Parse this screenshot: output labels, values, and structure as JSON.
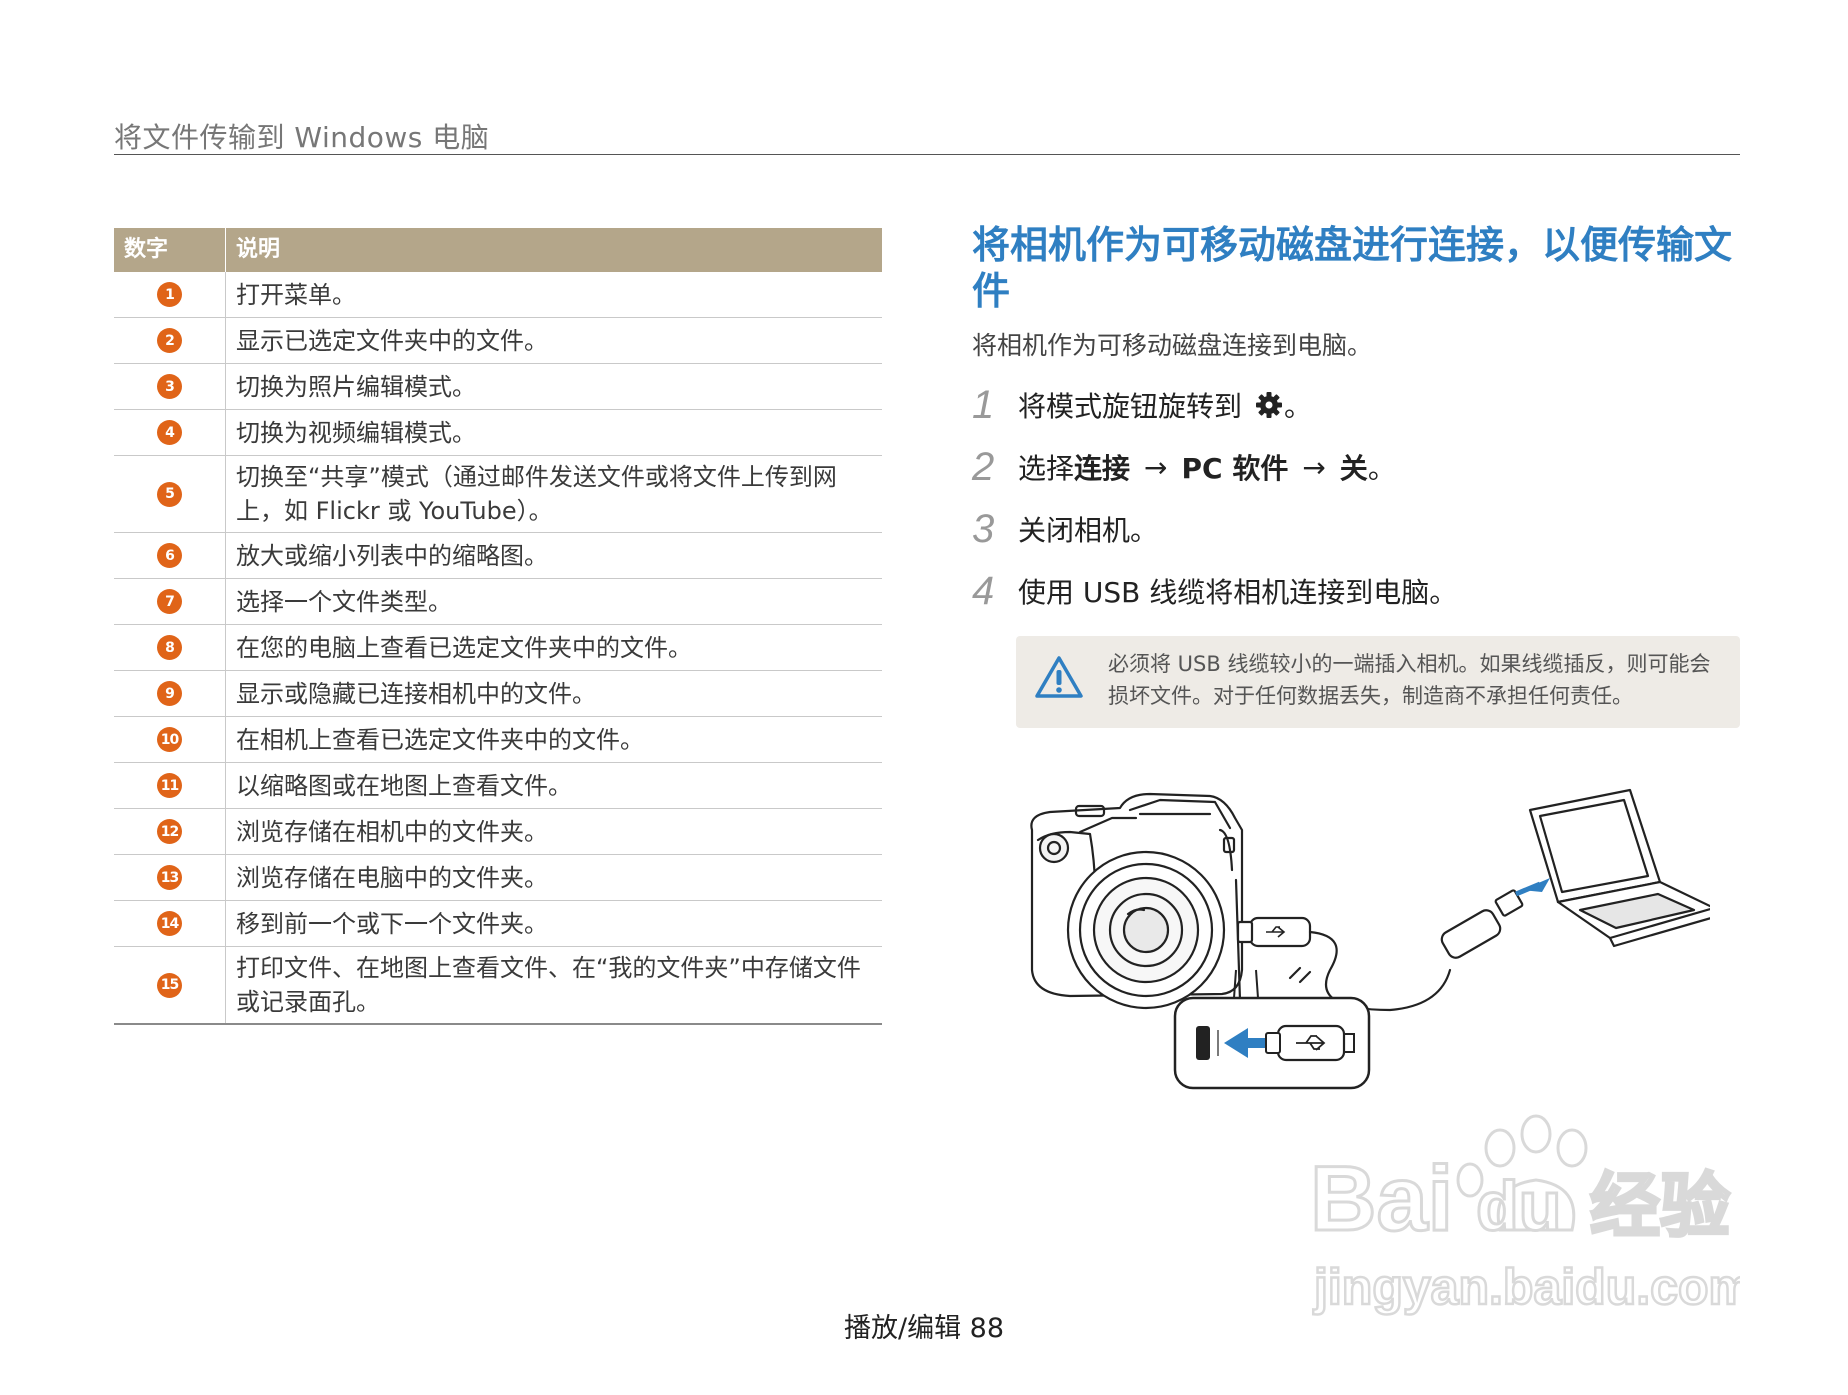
{
  "header": {
    "title": "将文件传输到 Windows 电脑"
  },
  "table": {
    "headers": [
      "数字",
      "说明"
    ],
    "rows": [
      {
        "num": "1",
        "desc": "打开菜单。"
      },
      {
        "num": "2",
        "desc": "显示已选定文件夹中的文件。"
      },
      {
        "num": "3",
        "desc": "切换为照片编辑模式。"
      },
      {
        "num": "4",
        "desc": "切换为视频编辑模式。"
      },
      {
        "num": "5",
        "desc": "切换至“共享”模式（通过邮件发送文件或将文件上传到网上，如 Flickr 或 YouTube）。"
      },
      {
        "num": "6",
        "desc": "放大或缩小列表中的缩略图。"
      },
      {
        "num": "7",
        "desc": "选择一个文件类型。"
      },
      {
        "num": "8",
        "desc": "在您的电脑上查看已选定文件夹中的文件。"
      },
      {
        "num": "9",
        "desc": "显示或隐藏已连接相机中的文件。"
      },
      {
        "num": "10",
        "desc": "在相机上查看已选定文件夹中的文件。"
      },
      {
        "num": "11",
        "desc": "以缩略图或在地图上查看文件。"
      },
      {
        "num": "12",
        "desc": "浏览存储在相机中的文件夹。"
      },
      {
        "num": "13",
        "desc": "浏览存储在电脑中的文件夹。"
      },
      {
        "num": "14",
        "desc": "移到前一个或下一个文件夹。"
      },
      {
        "num": "15",
        "desc": "打印文件、在地图上查看文件、在“我的文件夹”中存储文件或记录面孔。"
      }
    ]
  },
  "section": {
    "title": "将相机作为可移动磁盘进行连接，以便传输文件",
    "subtitle": "将相机作为可移动磁盘连接到电脑。",
    "steps": {
      "s1": {
        "n": "1",
        "text": "将模式旋钮旋转到",
        "end": "。"
      },
      "s2": {
        "n": "2",
        "pre": "选择",
        "b1": "连接",
        "arrow1": "→",
        "b2": "PC 软件",
        "arrow2": "→",
        "b3": "关",
        "end": "。"
      },
      "s3": {
        "n": "3",
        "text": "关闭相机。"
      },
      "s4": {
        "n": "4",
        "text": "使用 USB 线缆将相机连接到电脑。"
      }
    },
    "notice": "必须将 USB 线缆较小的一端插入相机。如果线缆插反，则可能会损坏文件。对于任何数据丢失，制造商不承担任何责任。"
  },
  "footer": {
    "text": "播放/编辑  88"
  },
  "watermark": {
    "brand": "Bai",
    "brand2": "du",
    "cn": "经验",
    "url": "jingyan.baidu.com"
  },
  "colors": {
    "accent": "#2f7fc2",
    "badge": "#e06418",
    "table_header": "#b4a68a"
  }
}
